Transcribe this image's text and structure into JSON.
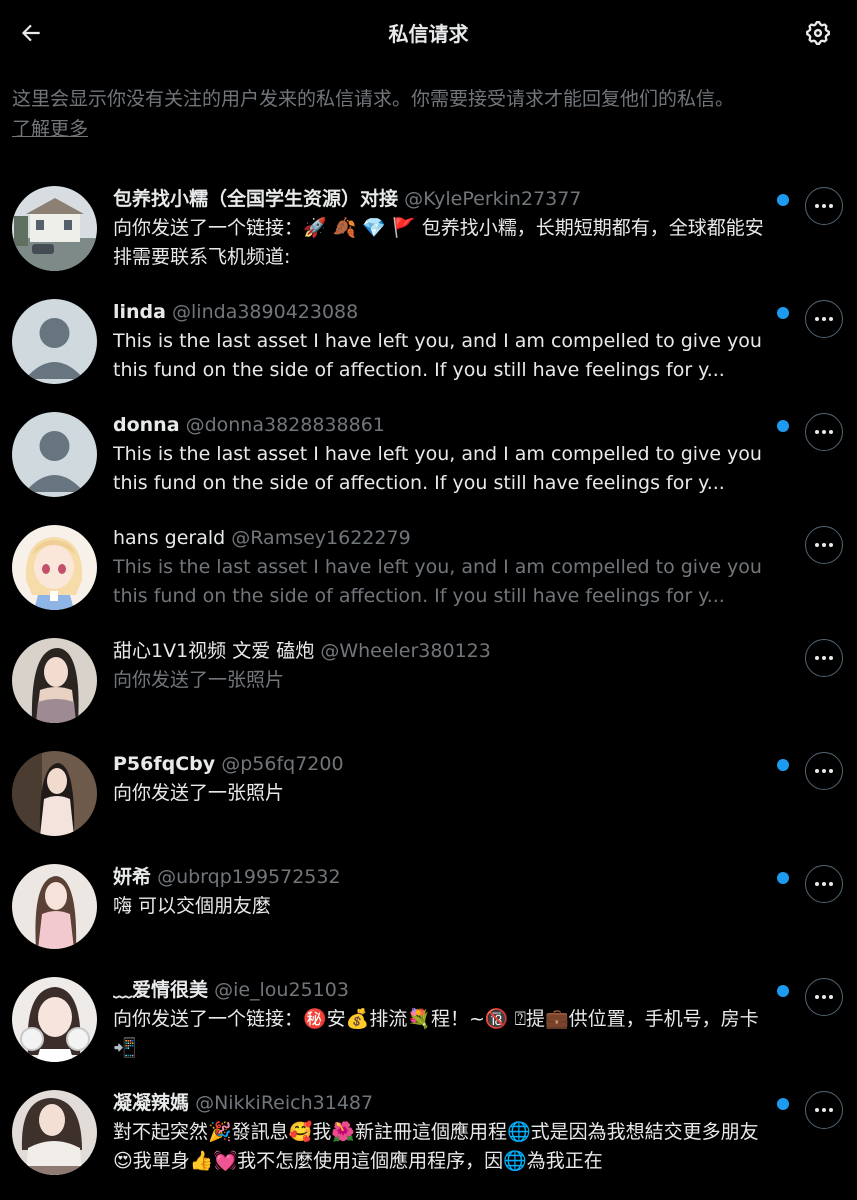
{
  "header": {
    "title": "私信请求",
    "back_icon": "arrow-left-icon",
    "settings_icon": "gear-icon"
  },
  "info": {
    "text": "这里会显示你没有关注的用户发来的私信请求。你需要接受请求才能回复他们的私信。",
    "link": "了解更多"
  },
  "colors": {
    "background": "#000000",
    "primary_text": "#e7e9ea",
    "secondary_text": "#71767b",
    "unread_dot": "#1d9bf0"
  },
  "requests": [
    {
      "name": "包养找小糯（全国学生资源）对接",
      "handle": "@KylePerkin27377",
      "message": "向你发送了一个链接：🚀 🍂 💎 🚩 包养找小糯，长期短期都有，全球都能安排需要联系飞机频道:",
      "unread": true
    },
    {
      "name": "linda",
      "handle": "@linda3890423088",
      "message": "This is the last asset I have left you, and I am compelled to give you this fund on the side of affection. If you still have feelings for y...",
      "unread": true
    },
    {
      "name": "donna",
      "handle": "@donna3828838861",
      "message": "This is the last asset I have left you, and I am compelled to give you this fund on the side of affection. If you still have feelings for y...",
      "unread": true
    },
    {
      "name": "hans gerald",
      "handle": "@Ramsey1622279",
      "message": "This is the last asset I have left you, and I am compelled to give you this fund on the side of affection. If you still have feelings for y...",
      "unread": false
    },
    {
      "name": "甜心1V1视频 文爱 磕炮",
      "handle": "@Wheeler380123",
      "message": "向你发送了一张照片",
      "unread": false
    },
    {
      "name": "P56fqCby",
      "handle": "@p56fq7200",
      "message": "向你发送了一张照片",
      "unread": true
    },
    {
      "name": "妍希",
      "handle": "@ubrqp199572532",
      "message": "嗨 可以交個朋友麼",
      "unread": true
    },
    {
      "name": "﹏爱情很美",
      "handle": "@ie_lou25103",
      "message": "向你发送了一个链接：㊙️安💰排流💐程！~🔞 ⍰提💼供位置，手机号，房卡📲",
      "unread": true
    },
    {
      "name": "凝凝辣媽",
      "handle": "@NikkiReich31487",
      "message": "對不起突然🎉發訊息🥰我🌺新註冊這個應用程🌐式是因為我想結交更多朋友😍我單身👍💓我不怎麼使用這個應用程序，因🌐為我正在",
      "unread": true
    }
  ]
}
